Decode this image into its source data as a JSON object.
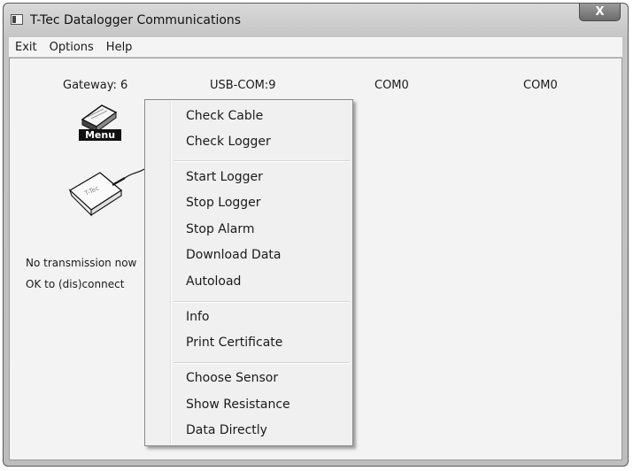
{
  "window": {
    "title": "T-Tec Datalogger Communications",
    "close_glyph": "X"
  },
  "menubar": {
    "items": [
      "Exit",
      "Options",
      "Help"
    ]
  },
  "ports": {
    "gateway": "Gateway: 6",
    "usb": "USB-COM:9",
    "com_a": "COM0",
    "com_b": "COM0"
  },
  "menu_icon": {
    "label": "Menu"
  },
  "device_icon": {
    "label": "T-Tec"
  },
  "status": {
    "line1": "No transmission now",
    "line2": "OK to (dis)connect"
  },
  "context_menu": {
    "items": [
      "Check Cable",
      "Check Logger",
      "Start Logger",
      "Stop Logger",
      "Stop Alarm",
      "Download Data",
      "Autoload",
      "Info",
      "Print Certificate",
      "Choose Sensor",
      "Show Resistance",
      "Data Directly"
    ]
  }
}
